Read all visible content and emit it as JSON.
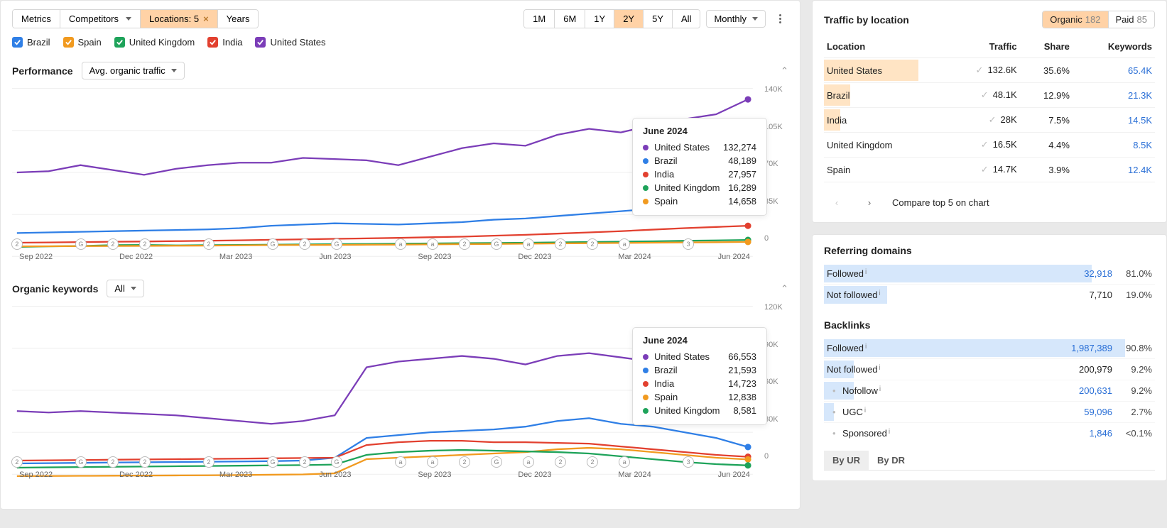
{
  "colors": {
    "brazil": "#2f7fe6",
    "spain": "#f19a1f",
    "uk": "#1ea35a",
    "india": "#e2402f",
    "us": "#7b3db8",
    "accent": "#ffd2a6"
  },
  "toolbar": {
    "metrics": "Metrics",
    "competitors": "Competitors",
    "locations": "Locations: 5",
    "years": "Years",
    "ranges": [
      "1M",
      "6M",
      "1Y",
      "2Y",
      "5Y",
      "All"
    ],
    "range_active": "2Y",
    "interval": "Monthly"
  },
  "legend": [
    {
      "id": "brazil",
      "label": "Brazil"
    },
    {
      "id": "spain",
      "label": "Spain"
    },
    {
      "id": "uk",
      "label": "United Kingdom"
    },
    {
      "id": "india",
      "label": "India"
    },
    {
      "id": "us",
      "label": "United States"
    }
  ],
  "perf": {
    "title": "Performance",
    "metric_dd": "Avg. organic traffic",
    "tooltip": {
      "title": "June 2024",
      "rows": [
        {
          "id": "us",
          "label": "United States",
          "value": "132,274"
        },
        {
          "id": "brazil",
          "label": "Brazil",
          "value": "48,189"
        },
        {
          "id": "india",
          "label": "India",
          "value": "27,957"
        },
        {
          "id": "uk",
          "label": "United Kingdom",
          "value": "16,289"
        },
        {
          "id": "spain",
          "label": "Spain",
          "value": "14,658"
        }
      ]
    }
  },
  "kw": {
    "title": "Organic keywords",
    "filter_dd": "All",
    "tooltip": {
      "title": "June 2024",
      "rows": [
        {
          "id": "us",
          "label": "United States",
          "value": "66,553"
        },
        {
          "id": "brazil",
          "label": "Brazil",
          "value": "21,593"
        },
        {
          "id": "india",
          "label": "India",
          "value": "14,723"
        },
        {
          "id": "spain",
          "label": "Spain",
          "value": "12,838"
        },
        {
          "id": "uk",
          "label": "United Kingdom",
          "value": "8,581"
        }
      ]
    }
  },
  "xaxis": [
    "Sep 2022",
    "Dec 2022",
    "Mar 2023",
    "Jun 2023",
    "Sep 2023",
    "Dec 2023",
    "Mar 2024",
    "Jun 2024"
  ],
  "traffic_panel": {
    "title": "Traffic by location",
    "pills": {
      "organic": "Organic",
      "organic_count": "182",
      "paid": "Paid",
      "paid_count": "85"
    },
    "cols": {
      "location": "Location",
      "traffic": "Traffic",
      "share": "Share",
      "keywords": "Keywords"
    },
    "rows": [
      {
        "loc": "United States",
        "traffic": "132.6K",
        "share": "35.6%",
        "kw": "65.4K",
        "barpct": 80
      },
      {
        "loc": "Brazil",
        "traffic": "48.1K",
        "share": "12.9%",
        "kw": "21.3K",
        "barpct": 22
      },
      {
        "loc": "India",
        "traffic": "28K",
        "share": "7.5%",
        "kw": "14.5K",
        "barpct": 14
      },
      {
        "loc": "United Kingdom",
        "traffic": "16.5K",
        "share": "4.4%",
        "kw": "8.5K",
        "barpct": 0
      },
      {
        "loc": "Spain",
        "traffic": "14.7K",
        "share": "3.9%",
        "kw": "12.4K",
        "barpct": 0
      }
    ],
    "compare": "Compare top 5 on chart"
  },
  "refdom": {
    "title": "Referring domains",
    "rows": [
      {
        "label": "Followed",
        "sup": "i",
        "num": "32,918",
        "pct": "81.0%",
        "bar": 81,
        "link": true
      },
      {
        "label": "Not followed",
        "sup": "i",
        "num": "7,710",
        "pct": "19.0%",
        "bar": 19,
        "link": false
      }
    ]
  },
  "backlinks": {
    "title": "Backlinks",
    "rows": [
      {
        "label": "Followed",
        "sup": "i",
        "num": "1,987,389",
        "pct": "90.8%",
        "bar": 91,
        "link": true,
        "sub": false
      },
      {
        "label": "Not followed",
        "sup": "i",
        "num": "200,979",
        "pct": "9.2%",
        "bar": 9,
        "link": false,
        "sub": false
      },
      {
        "label": "Nofollow",
        "sup": "i",
        "num": "200,631",
        "pct": "9.2%",
        "bar": 9,
        "link": true,
        "sub": true
      },
      {
        "label": "UGC",
        "sup": "i",
        "num": "59,096",
        "pct": "2.7%",
        "bar": 3,
        "link": true,
        "sub": true
      },
      {
        "label": "Sponsored",
        "sup": "i",
        "num": "1,846",
        "pct": "<0.1%",
        "bar": 0,
        "link": true,
        "sub": true
      }
    ],
    "tabs": {
      "ur": "By UR",
      "dr": "By DR"
    }
  },
  "chart_data": [
    {
      "type": "line",
      "title": "Performance — Avg. organic traffic",
      "xlabel": "",
      "ylabel": "",
      "ylim": [
        0,
        140000
      ],
      "yticks": [
        "140K",
        "105K",
        "70K",
        "35K",
        "0"
      ],
      "x": [
        "Jul 2022",
        "Aug 2022",
        "Sep 2022",
        "Oct 2022",
        "Nov 2022",
        "Dec 2022",
        "Jan 2023",
        "Feb 2023",
        "Mar 2023",
        "Apr 2023",
        "May 2023",
        "Jun 2023",
        "Jul 2023",
        "Aug 2023",
        "Sep 2023",
        "Oct 2023",
        "Nov 2023",
        "Dec 2023",
        "Jan 2024",
        "Feb 2024",
        "Mar 2024",
        "Apr 2024",
        "May 2024",
        "Jun 2024"
      ],
      "series": [
        {
          "name": "United States",
          "id": "us",
          "values": [
            72000,
            73000,
            78000,
            74000,
            70000,
            75000,
            78000,
            80000,
            80000,
            84000,
            83000,
            82000,
            78000,
            85000,
            92000,
            96000,
            94000,
            103000,
            108000,
            105000,
            111000,
            116000,
            120000,
            132274
          ]
        },
        {
          "name": "Brazil",
          "id": "brazil",
          "values": [
            22000,
            22500,
            23000,
            23500,
            24000,
            24500,
            25000,
            26000,
            28000,
            29000,
            30000,
            29500,
            29000,
            30000,
            31000,
            33000,
            34000,
            36000,
            38000,
            40000,
            42000,
            44000,
            46000,
            48189
          ]
        },
        {
          "name": "India",
          "id": "india",
          "values": [
            14000,
            14200,
            14500,
            14800,
            15000,
            15300,
            15600,
            16000,
            16400,
            16800,
            17200,
            17600,
            18000,
            18500,
            19000,
            19800,
            20500,
            21500,
            22500,
            23500,
            24800,
            26000,
            27000,
            27957
          ]
        },
        {
          "name": "United Kingdom",
          "id": "uk",
          "values": [
            10500,
            11000,
            11300,
            12000,
            12200,
            11800,
            12000,
            12200,
            12400,
            12600,
            12800,
            13000,
            13200,
            13400,
            13600,
            13800,
            14000,
            14300,
            14600,
            14900,
            15200,
            15600,
            15900,
            16289
          ]
        },
        {
          "name": "Spain",
          "id": "spain",
          "values": [
            11000,
            11100,
            11200,
            11300,
            11400,
            11500,
            11600,
            11800,
            12000,
            12100,
            12200,
            12300,
            12400,
            12600,
            12800,
            13000,
            13200,
            13400,
            13600,
            13800,
            14000,
            14200,
            14400,
            14658
          ]
        }
      ],
      "markers": [
        {
          "x": 0,
          "t": "2"
        },
        {
          "x": 2,
          "t": "G"
        },
        {
          "x": 3,
          "t": "2"
        },
        {
          "x": 4,
          "t": "2"
        },
        {
          "x": 6,
          "t": "2"
        },
        {
          "x": 8,
          "t": "G"
        },
        {
          "x": 9,
          "t": "2"
        },
        {
          "x": 10,
          "t": "G"
        },
        {
          "x": 12,
          "t": "a"
        },
        {
          "x": 13,
          "t": "a"
        },
        {
          "x": 14,
          "t": "2"
        },
        {
          "x": 15,
          "t": "G"
        },
        {
          "x": 16,
          "t": "a"
        },
        {
          "x": 17,
          "t": "2"
        },
        {
          "x": 18,
          "t": "2"
        },
        {
          "x": 19,
          "t": "a"
        },
        {
          "x": 21,
          "t": "3"
        }
      ]
    },
    {
      "type": "line",
      "title": "Organic keywords",
      "xlabel": "",
      "ylabel": "",
      "ylim": [
        0,
        120000
      ],
      "yticks": [
        "120K",
        "90K",
        "60K",
        "30K",
        "0"
      ],
      "x": [
        "Jul 2022",
        "Aug 2022",
        "Sep 2022",
        "Oct 2022",
        "Nov 2022",
        "Dec 2022",
        "Jan 2023",
        "Feb 2023",
        "Mar 2023",
        "Apr 2023",
        "May 2023",
        "Jun 2023",
        "Jul 2023",
        "Aug 2023",
        "Sep 2023",
        "Oct 2023",
        "Nov 2023",
        "Dec 2023",
        "Jan 2024",
        "Feb 2024",
        "Mar 2024",
        "Apr 2024",
        "May 2024",
        "Jun 2024"
      ],
      "series": [
        {
          "name": "United States",
          "id": "us",
          "values": [
            47000,
            46000,
            47000,
            46000,
            45000,
            44000,
            42000,
            40000,
            38000,
            40000,
            44000,
            78000,
            82000,
            84000,
            86000,
            84000,
            80000,
            86000,
            88000,
            85000,
            82000,
            80000,
            74000,
            66553
          ]
        },
        {
          "name": "Brazil",
          "id": "brazil",
          "values": [
            10000,
            10200,
            10400,
            10600,
            10800,
            11000,
            11200,
            11400,
            11600,
            12000,
            14000,
            28000,
            30000,
            32000,
            33000,
            34000,
            36000,
            40000,
            42000,
            38000,
            36000,
            32000,
            28000,
            21593
          ]
        },
        {
          "name": "India",
          "id": "india",
          "values": [
            12000,
            12200,
            12400,
            12600,
            12800,
            13000,
            13200,
            13400,
            13600,
            13800,
            14000,
            23000,
            25000,
            26000,
            26000,
            25000,
            25000,
            24500,
            24000,
            22000,
            20000,
            18000,
            16000,
            14723
          ]
        },
        {
          "name": "Spain",
          "id": "spain",
          "values": [
            1000,
            1100,
            1200,
            1300,
            1400,
            1500,
            1600,
            1800,
            2000,
            2200,
            3000,
            13000,
            14000,
            15000,
            16000,
            17000,
            18000,
            20000,
            21000,
            20000,
            18000,
            16000,
            14000,
            12838
          ]
        },
        {
          "name": "United Kingdom",
          "id": "uk",
          "values": [
            7000,
            7200,
            7400,
            7600,
            7800,
            8000,
            8200,
            8400,
            8600,
            8800,
            9200,
            16000,
            18000,
            19000,
            19500,
            19000,
            18500,
            18000,
            17000,
            15000,
            13000,
            11000,
            9500,
            8581
          ]
        }
      ],
      "markers": [
        {
          "x": 0,
          "t": "2"
        },
        {
          "x": 2,
          "t": "G"
        },
        {
          "x": 3,
          "t": "2"
        },
        {
          "x": 4,
          "t": "2"
        },
        {
          "x": 6,
          "t": "2"
        },
        {
          "x": 8,
          "t": "G"
        },
        {
          "x": 9,
          "t": "2"
        },
        {
          "x": 10,
          "t": "G"
        },
        {
          "x": 12,
          "t": "a"
        },
        {
          "x": 13,
          "t": "a"
        },
        {
          "x": 14,
          "t": "2"
        },
        {
          "x": 15,
          "t": "G"
        },
        {
          "x": 16,
          "t": "a"
        },
        {
          "x": 17,
          "t": "2"
        },
        {
          "x": 18,
          "t": "2"
        },
        {
          "x": 19,
          "t": "a"
        },
        {
          "x": 21,
          "t": "3"
        }
      ]
    }
  ]
}
